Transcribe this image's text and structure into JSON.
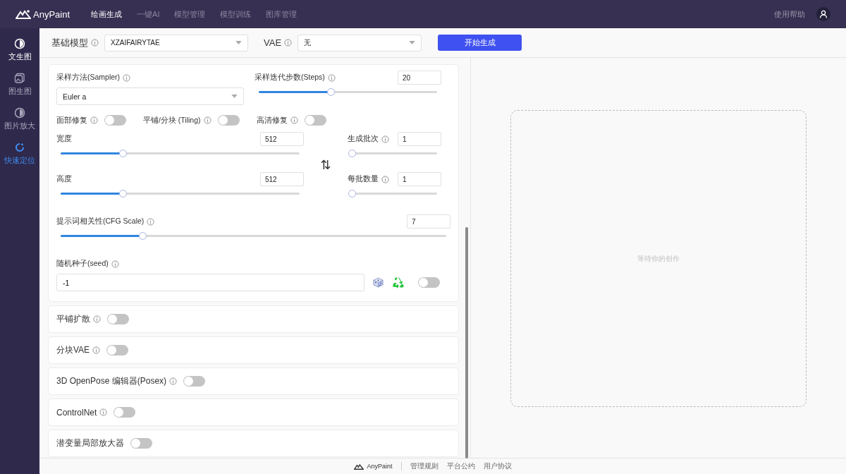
{
  "topbar": {
    "logo": "AnyPaint",
    "menu": [
      {
        "label": "绘画生成",
        "selected": true
      },
      {
        "label": "一键AI",
        "selected": false
      },
      {
        "label": "模型管理",
        "selected": false
      },
      {
        "label": "模型训练",
        "selected": false
      },
      {
        "label": "图库管理",
        "selected": false
      }
    ],
    "help": "使用帮助"
  },
  "sidebar": [
    {
      "label": "文生图",
      "kind": "contrast",
      "selected": true
    },
    {
      "label": "图生图",
      "kind": "image",
      "selected": false
    },
    {
      "label": "图片放大",
      "kind": "contrast",
      "selected": false
    },
    {
      "label": "快速定位",
      "kind": "locate",
      "selected": false
    }
  ],
  "toolbar": {
    "model_label": "基础模型",
    "model": "XZAIFAIRYTAE",
    "vae_label": "VAE",
    "vae": "无",
    "generate": "开始生成"
  },
  "params": {
    "sampler": {
      "label": "采样方法(Sampler)",
      "value": "Euler a"
    },
    "steps": {
      "label": "采样迭代步数(Steps)",
      "value": "20",
      "level": 0.385
    },
    "toggles": [
      {
        "label": "面部修复",
        "on": false
      },
      {
        "label": "平铺/分块 (Tiling)",
        "on": false
      },
      {
        "label": "高清修复",
        "on": false
      }
    ],
    "width": {
      "label": "宽度",
      "value": "512",
      "level": 0.25
    },
    "height": {
      "label": "高度",
      "value": "512",
      "level": 0.25
    },
    "swap": "⇅",
    "batch_count": {
      "label": "生成批次",
      "value": "1",
      "level": 0
    },
    "batch_size": {
      "label": "每批数量",
      "value": "1",
      "level": 0
    },
    "cfg": {
      "label": "提示词相关性(CFG Scale)",
      "value": "7",
      "level": 0.207
    },
    "seed": {
      "label": "随机种子(seed)",
      "value": "-1",
      "on": false
    }
  },
  "sections": [
    {
      "label": "平铺扩散",
      "info": true,
      "on": false
    },
    {
      "label": "分块VAE",
      "info": true,
      "on": false
    },
    {
      "label": "3D OpenPose 编辑器(Posex)",
      "info": true,
      "on": false
    },
    {
      "label": "ControlNet",
      "info": true,
      "on": false
    },
    {
      "label": "潜变量局部放大器",
      "info": false,
      "on": false
    }
  ],
  "preview": {
    "placeholder": "等待你的创作"
  },
  "footer": {
    "logo": "AnyPaint",
    "links": [
      "管理规则",
      "平台公约",
      "用户协议"
    ]
  }
}
